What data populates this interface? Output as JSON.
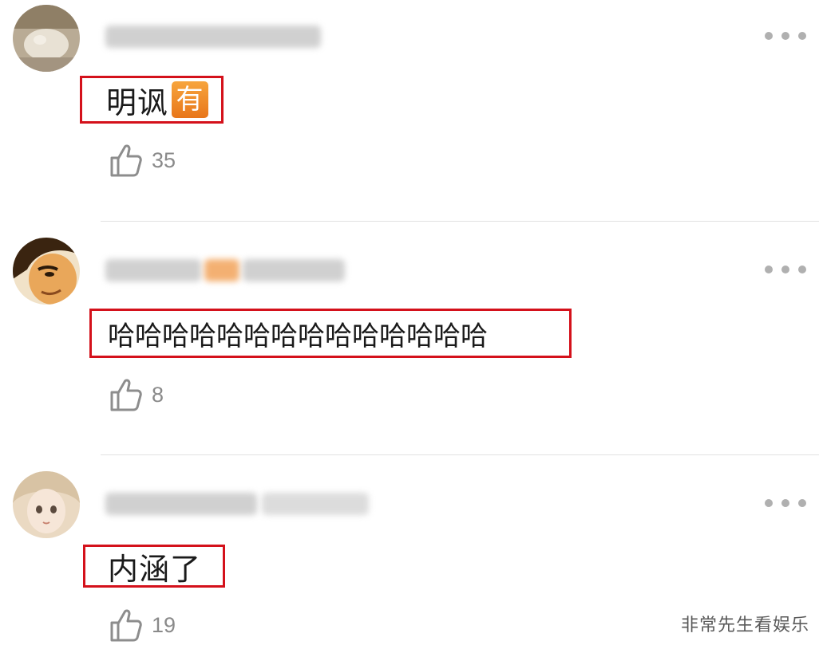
{
  "comments": [
    {
      "text": "明讽",
      "emoji": "有",
      "likes": "35"
    },
    {
      "text": "哈哈哈哈哈哈哈哈哈哈哈哈哈哈",
      "likes": "8"
    },
    {
      "text": "内涵了",
      "likes": "19"
    }
  ],
  "icons": {
    "like": "thumbs-up-icon",
    "more": "more-icon"
  },
  "colors": {
    "highlight_border": "#d4111b",
    "emoji_bg": "#f08a26",
    "like_count": "#8a8a8a"
  },
  "watermark": "非常先生看娱乐"
}
